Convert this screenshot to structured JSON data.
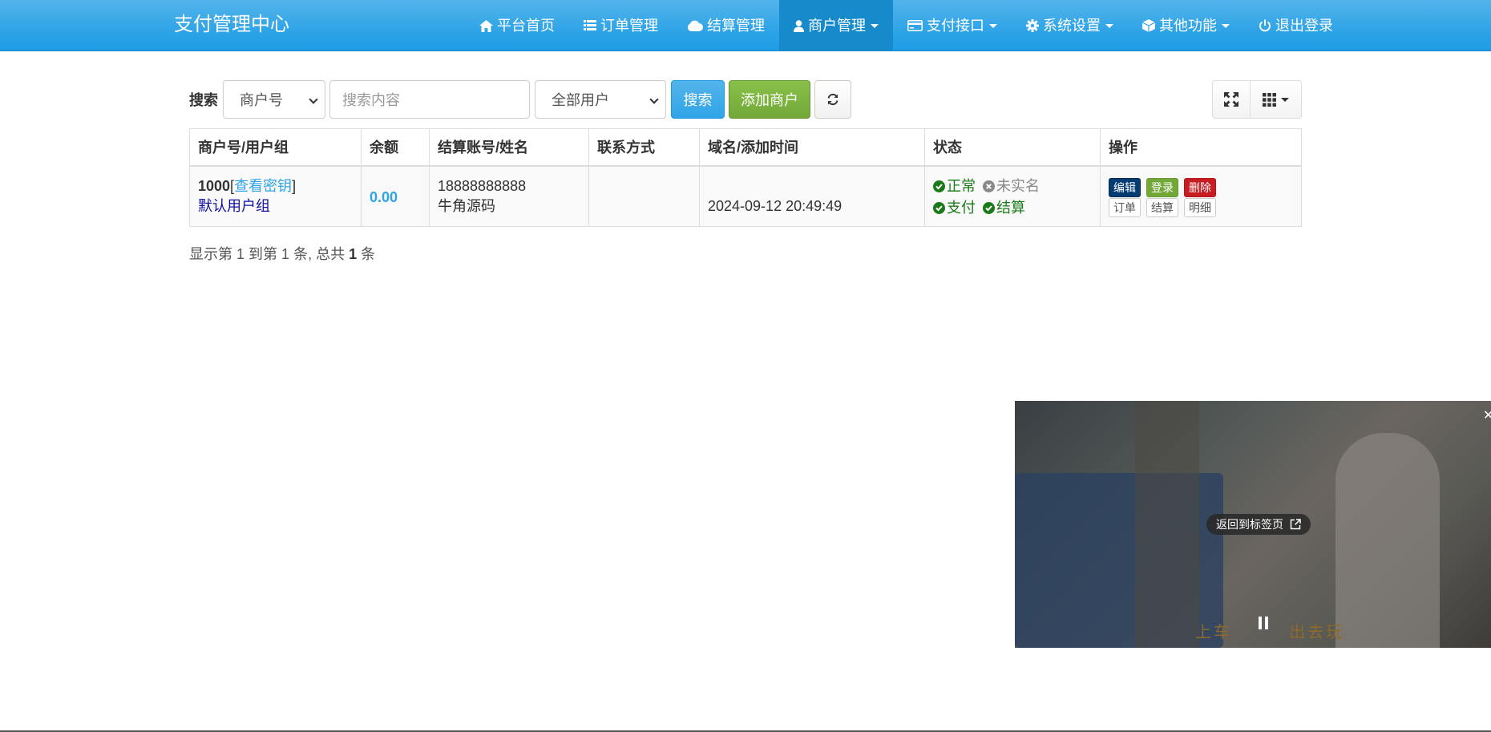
{
  "navbar": {
    "brand": "支付管理中心",
    "items": [
      {
        "label": "平台首页",
        "icon": "home-icon"
      },
      {
        "label": "订单管理",
        "icon": "list-icon"
      },
      {
        "label": "结算管理",
        "icon": "cloud-icon"
      },
      {
        "label": "商户管理",
        "icon": "user-icon",
        "active": true,
        "dropdown": true
      },
      {
        "label": "支付接口",
        "icon": "credit-card-icon",
        "dropdown": true
      },
      {
        "label": "系统设置",
        "icon": "gear-icon",
        "dropdown": true
      },
      {
        "label": "其他功能",
        "icon": "cube-icon",
        "dropdown": true
      },
      {
        "label": "退出登录",
        "icon": "power-icon"
      }
    ]
  },
  "toolbar": {
    "search_label": "搜索",
    "field_select": "商户号",
    "search_placeholder": "搜索内容",
    "user_filter": "全部用户",
    "search_button": "搜索",
    "add_button": "添加商户"
  },
  "table": {
    "headers": [
      "商户号/用户组",
      "余额",
      "结算账号/姓名",
      "联系方式",
      "域名/添加时间",
      "状态",
      "操作"
    ],
    "rows": [
      {
        "uid": "1000",
        "bracket_open": "[",
        "view_key": "查看密钥",
        "bracket_close": "]",
        "group": "默认用户组",
        "balance": "0.00",
        "account": "18888888888",
        "name": "牛角源码",
        "contact": "",
        "domain": "",
        "added_time": "2024-09-12 20:49:49",
        "status": {
          "normal": "正常",
          "realname": "未实名",
          "pay": "支付",
          "settle": "结算"
        },
        "actions": {
          "edit": "编辑",
          "login": "登录",
          "delete": "删除",
          "orders": "订单",
          "settle": "结算",
          "detail": "明细"
        }
      }
    ]
  },
  "summary": {
    "prefix": "显示第 ",
    "from": "1",
    "mid1": " 到第 ",
    "to": "1",
    "mid2": " 条, 总共 ",
    "total": "1",
    "suffix": " 条"
  },
  "video": {
    "back_to_tab": "返回到标签页",
    "subtitle_left": "上车 ",
    "subtitle_right": " 出去玩"
  },
  "colors": {
    "navbar": "#2fa4e7",
    "nav_active": "#178acc",
    "success": "#73a839",
    "danger": "#c71c22",
    "dark_blue": "#033c73"
  }
}
